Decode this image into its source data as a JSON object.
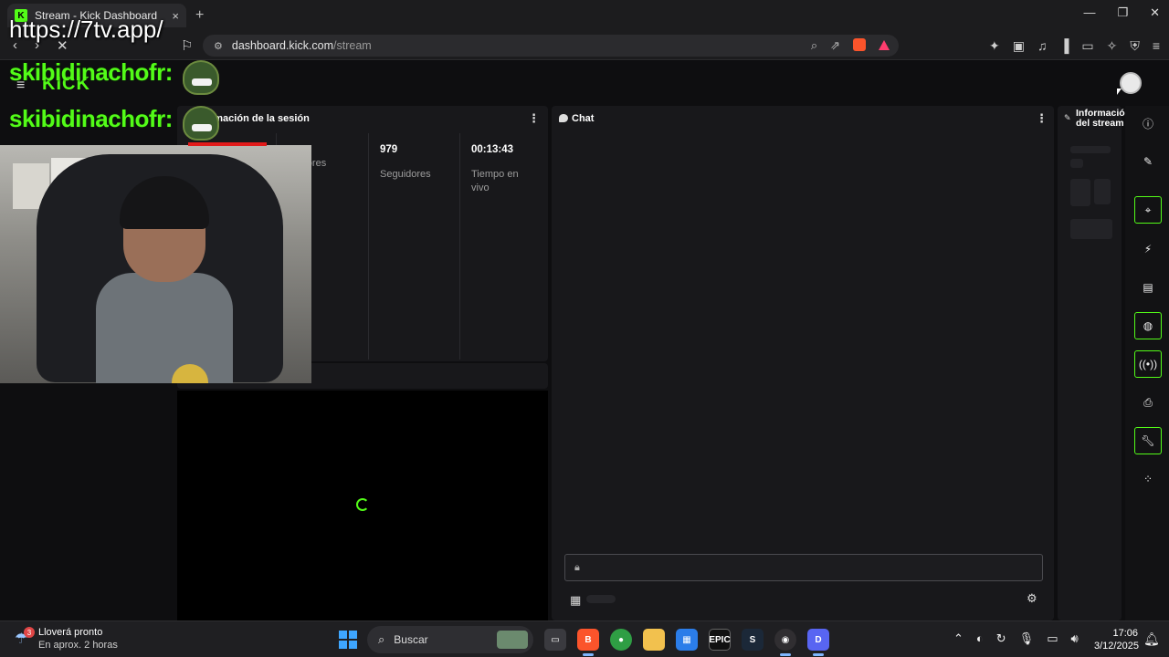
{
  "browser": {
    "tab_title": "Stream - Kick Dashboard",
    "tab_close": "×",
    "new_tab": "+",
    "url_host": "dashboard.kick.com",
    "url_path": "/stream",
    "window_minimize": "—",
    "window_restore": "❐",
    "window_close": "✕"
  },
  "overlay": {
    "url_text": "https://7tv.app/",
    "chat_user_1": "skibidinachofr:",
    "chat_user_2": "skibidinachofr:"
  },
  "app": {
    "logo": "KICK",
    "session_panel": {
      "title": "rmación de la sesión",
      "stats": [
        {
          "value": "",
          "label": "ctadores"
        },
        {
          "value": "979",
          "label": "Seguidores"
        },
        {
          "value": "00:13:43",
          "label": "Tiempo en vivo"
        }
      ]
    },
    "chat_panel": {
      "title": "Chat"
    },
    "info_panel": {
      "title": "Informació del stream"
    }
  },
  "taskbar": {
    "weather_title": "Lloverá pronto",
    "weather_sub": "En aprox. 2 horas",
    "weather_badge": "3",
    "search_label": "Buscar",
    "time": "17:06",
    "date": "3/12/2025",
    "apps": [
      "task-view",
      "brave",
      "chrome",
      "file-explorer",
      "microsoft-store",
      "epic-games",
      "steam",
      "obs",
      "discord"
    ]
  },
  "colors": {
    "kick_green": "#53fc18",
    "panel_bg": "#18181b",
    "page_bg": "#0e0e10"
  }
}
